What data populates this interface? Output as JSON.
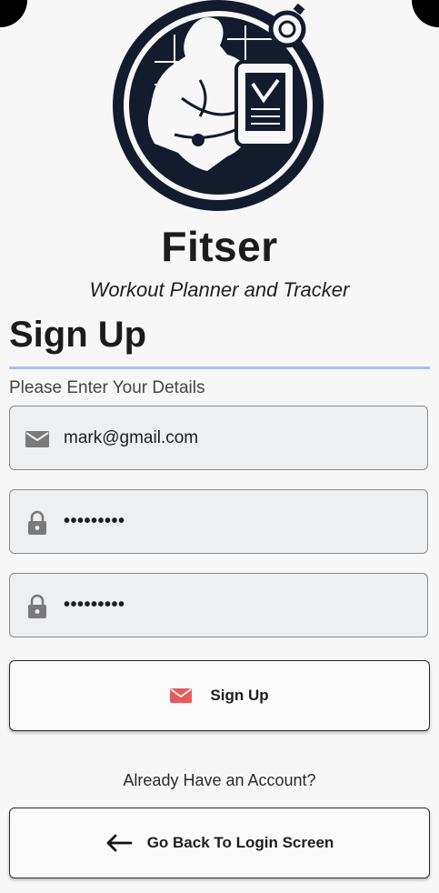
{
  "app": {
    "name": "Fitser",
    "tagline": "Workout Planner and Tracker"
  },
  "form": {
    "title": "Sign Up",
    "subtitle": "Please Enter Your Details",
    "email_value": "mark@gmail.com",
    "password_value": "•••••••••",
    "confirm_password_value": "•••••••••"
  },
  "buttons": {
    "signup_label": "Sign Up",
    "already_text": "Already Have an Account?",
    "back_label": "Go Back To Login Screen"
  },
  "icons": {
    "email": "mail-icon",
    "password": "lock-icon",
    "signup": "mail-icon",
    "back": "arrow-left-icon"
  },
  "colors": {
    "accent_divider": "#a9bff2",
    "signup_icon": "#e85a5a",
    "logo_dark": "#141b2c"
  }
}
